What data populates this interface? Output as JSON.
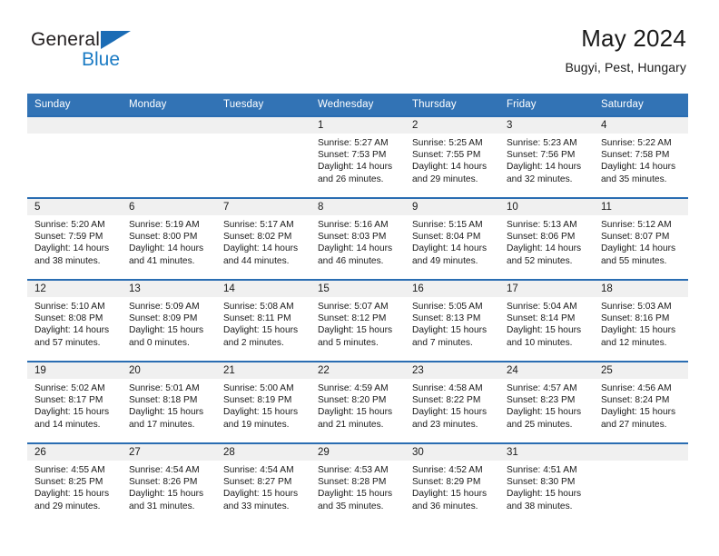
{
  "brand": {
    "name_part1": "General",
    "name_part2": "Blue",
    "mark": "triangle-logo"
  },
  "header": {
    "title": "May 2024",
    "location": "Bugyi, Pest, Hungary"
  },
  "weekdays": [
    "Sunday",
    "Monday",
    "Tuesday",
    "Wednesday",
    "Thursday",
    "Friday",
    "Saturday"
  ],
  "labels": {
    "sunrise": "Sunrise:",
    "sunset": "Sunset:",
    "daylight": "Daylight:"
  },
  "colors": {
    "header_blue": "#3273b5",
    "border_blue": "#2a6db2",
    "daynum_band": "#f0f0f0",
    "brand_blue": "#1b7bc4"
  },
  "weeks": [
    [
      {
        "day": "",
        "lines": []
      },
      {
        "day": "",
        "lines": []
      },
      {
        "day": "",
        "lines": []
      },
      {
        "day": "1",
        "lines": [
          "Sunrise: 5:27 AM",
          "Sunset: 7:53 PM",
          "Daylight: 14 hours and 26 minutes."
        ]
      },
      {
        "day": "2",
        "lines": [
          "Sunrise: 5:25 AM",
          "Sunset: 7:55 PM",
          "Daylight: 14 hours and 29 minutes."
        ]
      },
      {
        "day": "3",
        "lines": [
          "Sunrise: 5:23 AM",
          "Sunset: 7:56 PM",
          "Daylight: 14 hours and 32 minutes."
        ]
      },
      {
        "day": "4",
        "lines": [
          "Sunrise: 5:22 AM",
          "Sunset: 7:58 PM",
          "Daylight: 14 hours and 35 minutes."
        ]
      }
    ],
    [
      {
        "day": "5",
        "lines": [
          "Sunrise: 5:20 AM",
          "Sunset: 7:59 PM",
          "Daylight: 14 hours and 38 minutes."
        ]
      },
      {
        "day": "6",
        "lines": [
          "Sunrise: 5:19 AM",
          "Sunset: 8:00 PM",
          "Daylight: 14 hours and 41 minutes."
        ]
      },
      {
        "day": "7",
        "lines": [
          "Sunrise: 5:17 AM",
          "Sunset: 8:02 PM",
          "Daylight: 14 hours and 44 minutes."
        ]
      },
      {
        "day": "8",
        "lines": [
          "Sunrise: 5:16 AM",
          "Sunset: 8:03 PM",
          "Daylight: 14 hours and 46 minutes."
        ]
      },
      {
        "day": "9",
        "lines": [
          "Sunrise: 5:15 AM",
          "Sunset: 8:04 PM",
          "Daylight: 14 hours and 49 minutes."
        ]
      },
      {
        "day": "10",
        "lines": [
          "Sunrise: 5:13 AM",
          "Sunset: 8:06 PM",
          "Daylight: 14 hours and 52 minutes."
        ]
      },
      {
        "day": "11",
        "lines": [
          "Sunrise: 5:12 AM",
          "Sunset: 8:07 PM",
          "Daylight: 14 hours and 55 minutes."
        ]
      }
    ],
    [
      {
        "day": "12",
        "lines": [
          "Sunrise: 5:10 AM",
          "Sunset: 8:08 PM",
          "Daylight: 14 hours and 57 minutes."
        ]
      },
      {
        "day": "13",
        "lines": [
          "Sunrise: 5:09 AM",
          "Sunset: 8:09 PM",
          "Daylight: 15 hours and 0 minutes."
        ]
      },
      {
        "day": "14",
        "lines": [
          "Sunrise: 5:08 AM",
          "Sunset: 8:11 PM",
          "Daylight: 15 hours and 2 minutes."
        ]
      },
      {
        "day": "15",
        "lines": [
          "Sunrise: 5:07 AM",
          "Sunset: 8:12 PM",
          "Daylight: 15 hours and 5 minutes."
        ]
      },
      {
        "day": "16",
        "lines": [
          "Sunrise: 5:05 AM",
          "Sunset: 8:13 PM",
          "Daylight: 15 hours and 7 minutes."
        ]
      },
      {
        "day": "17",
        "lines": [
          "Sunrise: 5:04 AM",
          "Sunset: 8:14 PM",
          "Daylight: 15 hours and 10 minutes."
        ]
      },
      {
        "day": "18",
        "lines": [
          "Sunrise: 5:03 AM",
          "Sunset: 8:16 PM",
          "Daylight: 15 hours and 12 minutes."
        ]
      }
    ],
    [
      {
        "day": "19",
        "lines": [
          "Sunrise: 5:02 AM",
          "Sunset: 8:17 PM",
          "Daylight: 15 hours and 14 minutes."
        ]
      },
      {
        "day": "20",
        "lines": [
          "Sunrise: 5:01 AM",
          "Sunset: 8:18 PM",
          "Daylight: 15 hours and 17 minutes."
        ]
      },
      {
        "day": "21",
        "lines": [
          "Sunrise: 5:00 AM",
          "Sunset: 8:19 PM",
          "Daylight: 15 hours and 19 minutes."
        ]
      },
      {
        "day": "22",
        "lines": [
          "Sunrise: 4:59 AM",
          "Sunset: 8:20 PM",
          "Daylight: 15 hours and 21 minutes."
        ]
      },
      {
        "day": "23",
        "lines": [
          "Sunrise: 4:58 AM",
          "Sunset: 8:22 PM",
          "Daylight: 15 hours and 23 minutes."
        ]
      },
      {
        "day": "24",
        "lines": [
          "Sunrise: 4:57 AM",
          "Sunset: 8:23 PM",
          "Daylight: 15 hours and 25 minutes."
        ]
      },
      {
        "day": "25",
        "lines": [
          "Sunrise: 4:56 AM",
          "Sunset: 8:24 PM",
          "Daylight: 15 hours and 27 minutes."
        ]
      }
    ],
    [
      {
        "day": "26",
        "lines": [
          "Sunrise: 4:55 AM",
          "Sunset: 8:25 PM",
          "Daylight: 15 hours and 29 minutes."
        ]
      },
      {
        "day": "27",
        "lines": [
          "Sunrise: 4:54 AM",
          "Sunset: 8:26 PM",
          "Daylight: 15 hours and 31 minutes."
        ]
      },
      {
        "day": "28",
        "lines": [
          "Sunrise: 4:54 AM",
          "Sunset: 8:27 PM",
          "Daylight: 15 hours and 33 minutes."
        ]
      },
      {
        "day": "29",
        "lines": [
          "Sunrise: 4:53 AM",
          "Sunset: 8:28 PM",
          "Daylight: 15 hours and 35 minutes."
        ]
      },
      {
        "day": "30",
        "lines": [
          "Sunrise: 4:52 AM",
          "Sunset: 8:29 PM",
          "Daylight: 15 hours and 36 minutes."
        ]
      },
      {
        "day": "31",
        "lines": [
          "Sunrise: 4:51 AM",
          "Sunset: 8:30 PM",
          "Daylight: 15 hours and 38 minutes."
        ]
      },
      {
        "day": "",
        "lines": []
      }
    ]
  ]
}
